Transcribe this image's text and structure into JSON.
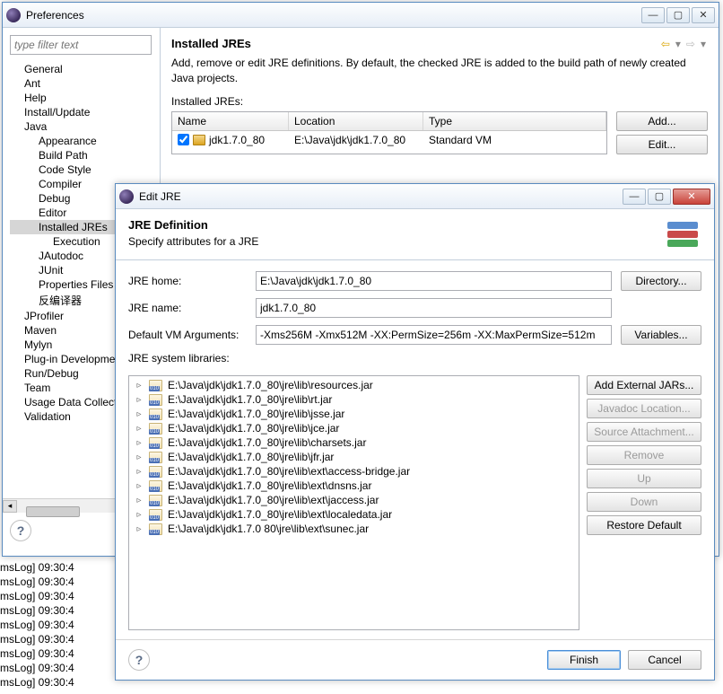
{
  "pref": {
    "title": "Preferences",
    "filter_placeholder": "type filter text",
    "tree": [
      {
        "label": "General",
        "ind": 1
      },
      {
        "label": "Ant",
        "ind": 1
      },
      {
        "label": "Help",
        "ind": 1
      },
      {
        "label": "Install/Update",
        "ind": 1
      },
      {
        "label": "Java",
        "ind": 1
      },
      {
        "label": "Appearance",
        "ind": 2
      },
      {
        "label": "Build Path",
        "ind": 2
      },
      {
        "label": "Code Style",
        "ind": 2
      },
      {
        "label": "Compiler",
        "ind": 2
      },
      {
        "label": "Debug",
        "ind": 2
      },
      {
        "label": "Editor",
        "ind": 2
      },
      {
        "label": "Installed JREs",
        "ind": 2,
        "sel": true
      },
      {
        "label": "Execution",
        "ind": 3
      },
      {
        "label": "JAutodoc",
        "ind": 2
      },
      {
        "label": "JUnit",
        "ind": 2
      },
      {
        "label": "Properties Files",
        "ind": 2
      },
      {
        "label": "反编译器",
        "ind": 2
      },
      {
        "label": "JProfiler",
        "ind": 1
      },
      {
        "label": "Maven",
        "ind": 1
      },
      {
        "label": "Mylyn",
        "ind": 1
      },
      {
        "label": "Plug-in Development",
        "ind": 1
      },
      {
        "label": "Run/Debug",
        "ind": 1
      },
      {
        "label": "Team",
        "ind": 1
      },
      {
        "label": "Usage Data Collector",
        "ind": 1
      },
      {
        "label": "Validation",
        "ind": 1
      }
    ],
    "page_title": "Installed JREs",
    "page_desc": "Add, remove or edit JRE definitions. By default, the checked JRE is added to the build path of newly created Java projects.",
    "table_label": "Installed JREs:",
    "columns": {
      "name": "Name",
      "location": "Location",
      "type": "Type"
    },
    "row": {
      "name": "jdk1.7.0_80",
      "location": "E:\\Java\\jdk\\jdk1.7.0_80",
      "type": "Standard VM"
    },
    "buttons": {
      "add": "Add...",
      "edit": "Edit..."
    }
  },
  "editjre": {
    "title": "Edit JRE",
    "banner_title": "JRE Definition",
    "banner_sub": "Specify attributes for a JRE",
    "labels": {
      "home": "JRE home:",
      "name": "JRE name:",
      "args": "Default VM Arguments:",
      "libs": "JRE system libraries:"
    },
    "values": {
      "home": "E:\\Java\\jdk\\jdk1.7.0_80",
      "name": "jdk1.7.0_80",
      "args": "-Xms256M -Xmx512M -XX:PermSize=256m -XX:MaxPermSize=512m"
    },
    "buttons": {
      "directory": "Directory...",
      "variables": "Variables...",
      "add_ext": "Add External JARs...",
      "javadoc": "Javadoc Location...",
      "source": "Source Attachment...",
      "remove": "Remove",
      "up": "Up",
      "down": "Down",
      "restore": "Restore Default",
      "finish": "Finish",
      "cancel": "Cancel"
    },
    "libs": [
      "E:\\Java\\jdk\\jdk1.7.0_80\\jre\\lib\\resources.jar",
      "E:\\Java\\jdk\\jdk1.7.0_80\\jre\\lib\\rt.jar",
      "E:\\Java\\jdk\\jdk1.7.0_80\\jre\\lib\\jsse.jar",
      "E:\\Java\\jdk\\jdk1.7.0_80\\jre\\lib\\jce.jar",
      "E:\\Java\\jdk\\jdk1.7.0_80\\jre\\lib\\charsets.jar",
      "E:\\Java\\jdk\\jdk1.7.0_80\\jre\\lib\\jfr.jar",
      "E:\\Java\\jdk\\jdk1.7.0_80\\jre\\lib\\ext\\access-bridge.jar",
      "E:\\Java\\jdk\\jdk1.7.0_80\\jre\\lib\\ext\\dnsns.jar",
      "E:\\Java\\jdk\\jdk1.7.0_80\\jre\\lib\\ext\\jaccess.jar",
      "E:\\Java\\jdk\\jdk1.7.0_80\\jre\\lib\\ext\\localedata.jar",
      "E:\\Java\\jdk\\jdk1.7.0 80\\jre\\lib\\ext\\sunec.jar"
    ]
  },
  "console": [
    "msLog] 09:30:4",
    "msLog] 09:30:4",
    "msLog] 09:30:4",
    "msLog] 09:30:4",
    "msLog] 09:30:4",
    "msLog] 09:30:4",
    "msLog] 09:30:4",
    "msLog] 09:30:4",
    "msLog] 09:30:4"
  ]
}
